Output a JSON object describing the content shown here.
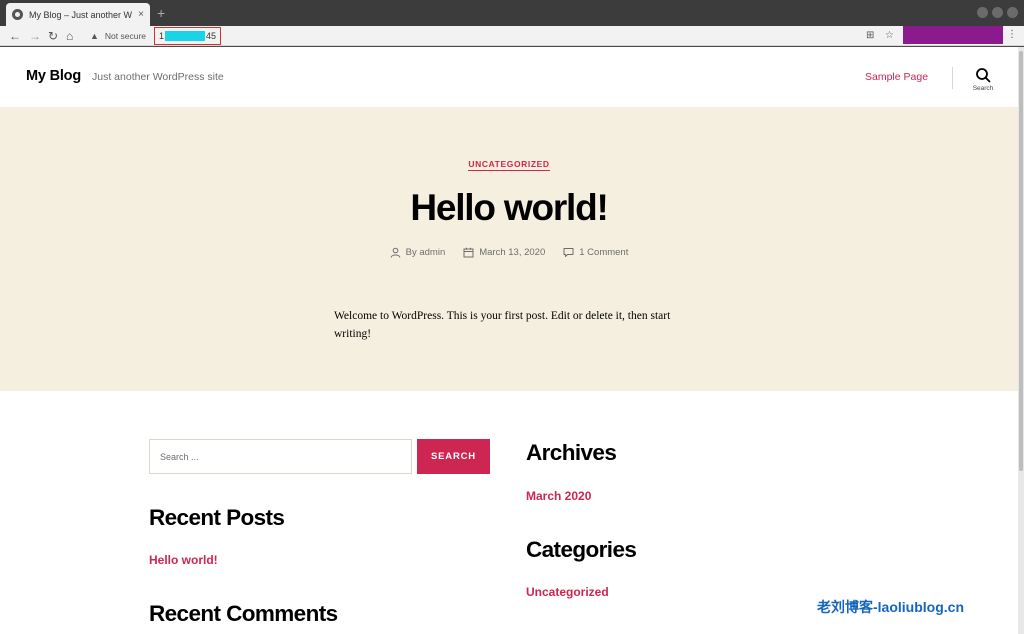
{
  "browser": {
    "tab_title": "My Blog – Just another W",
    "tab_close": "×",
    "new_tab": "+",
    "not_secure": "Not secure",
    "url_prefix": "1",
    "url_suffix": "45"
  },
  "site": {
    "title": "My Blog",
    "description": "Just another WordPress site",
    "nav_item": "Sample Page",
    "search_label": "Search"
  },
  "post": {
    "category": "UNCATEGORIZED",
    "title": "Hello world!",
    "author": "By admin",
    "date": "March 13, 2020",
    "comments": "1 Comment",
    "content": "Welcome to WordPress. This is your first post. Edit or delete it, then start writing!"
  },
  "widgets": {
    "search_placeholder": "Search ...",
    "search_button": "SEARCH",
    "recent_posts_title": "Recent Posts",
    "recent_posts": [
      "Hello world!"
    ],
    "recent_comments_title": "Recent Comments",
    "archives_title": "Archives",
    "archives": [
      "March 2020"
    ],
    "categories_title": "Categories",
    "categories": [
      "Uncategorized"
    ]
  },
  "watermark": "老刘博客-laoliublog.cn",
  "colors": {
    "accent": "#cd2653",
    "hero_bg": "#f5efe0",
    "url_highlight": "#d32f2f",
    "redaction": "#19d3e6",
    "extension_block": "#8a1a8e"
  },
  "icons": [
    "back-icon",
    "forward-icon",
    "reload-icon",
    "home-icon",
    "warning-icon",
    "translate-icon",
    "star-icon",
    "menu-icon",
    "search-icon",
    "user-icon",
    "calendar-icon",
    "comment-icon"
  ]
}
